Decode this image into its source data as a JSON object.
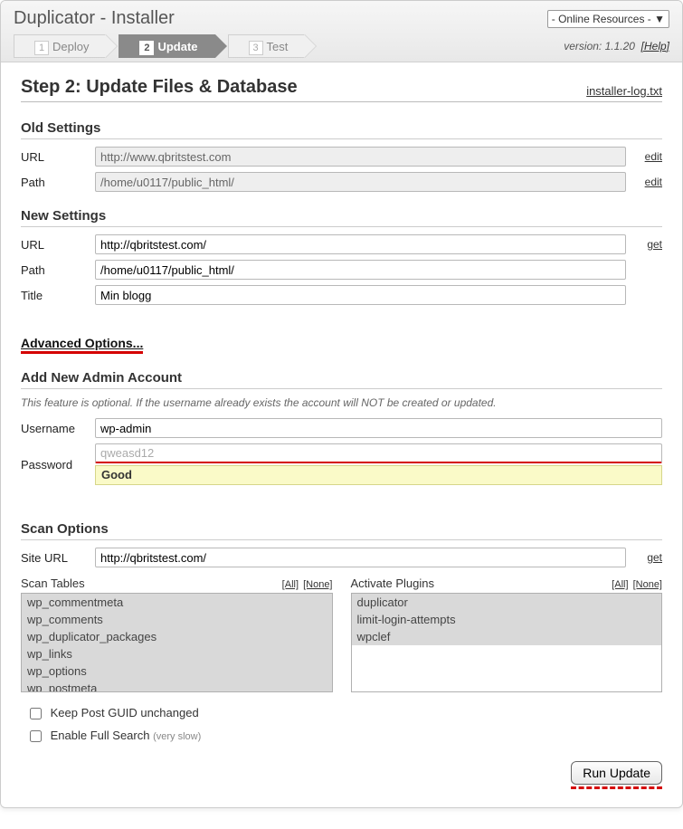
{
  "header": {
    "app_title": "Duplicator - Installer",
    "online_resources": "- Online Resources - ▼",
    "version_prefix": "version: ",
    "version": "1.1.20",
    "help": "[Help]"
  },
  "wizard": {
    "steps": [
      {
        "num": "1",
        "label": "Deploy",
        "active": false
      },
      {
        "num": "2",
        "label": "Update",
        "active": true
      },
      {
        "num": "3",
        "label": "Test",
        "active": false
      }
    ]
  },
  "step_head": {
    "title": "Step 2: Update Files & Database",
    "log_link": "installer-log.txt"
  },
  "old_settings": {
    "title": "Old Settings",
    "url_label": "URL",
    "url_value": "http://www.qbritstest.com",
    "path_label": "Path",
    "path_value": "/home/u0117/public_html/",
    "edit": "edit"
  },
  "new_settings": {
    "title": "New Settings",
    "url_label": "URL",
    "url_value": "http://qbritstest.com/",
    "path_label": "Path",
    "path_value": "/home/u0117/public_html/",
    "title_label": "Title",
    "title_value": "Min blogg",
    "get": "get"
  },
  "adv_link": "Advanced Options...",
  "admin": {
    "title": "Add New Admin Account",
    "hint": "This feature is optional. If the username already exists the account will NOT be created or updated.",
    "user_label": "Username",
    "user_value": "wp-admin",
    "pass_label": "Password",
    "pass_value": "qweasd12",
    "strength": "Good"
  },
  "scan": {
    "title": "Scan Options",
    "siteurl_label": "Site URL",
    "siteurl_value": "http://qbritstest.com/",
    "get": "get",
    "tables_title": "Scan Tables",
    "plugins_title": "Activate Plugins",
    "all": "[All]",
    "none": "[None]",
    "tables": [
      "wp_commentmeta",
      "wp_comments",
      "wp_duplicator_packages",
      "wp_links",
      "wp_options",
      "wp_postmeta"
    ],
    "plugins": [
      "duplicator",
      "limit-login-attempts",
      "wpclef"
    ]
  },
  "checks": {
    "guid": "Keep Post GUID unchanged",
    "fullsearch": "Enable Full Search",
    "very_slow": "(very slow)"
  },
  "run_button": "Run Update"
}
